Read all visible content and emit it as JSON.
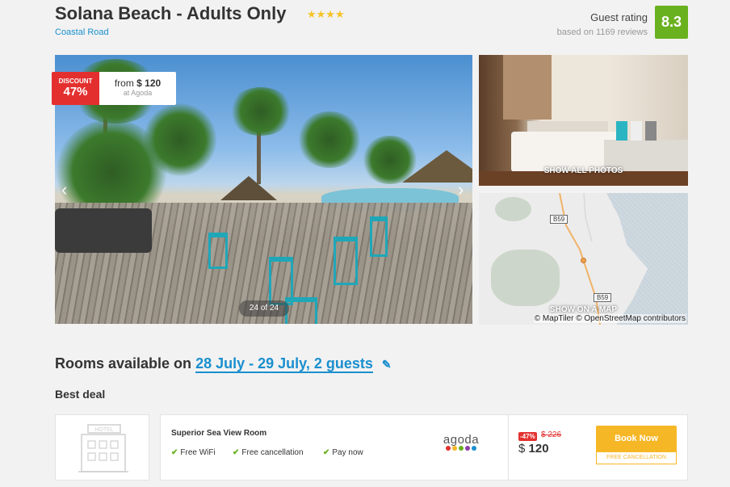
{
  "header": {
    "title": "Solana Beach - Adults Only",
    "stars": "★★★★",
    "address": "Coastal Road",
    "rating_label": "Guest rating",
    "rating_sub": "based on 1169 reviews",
    "rating_score": "8.3"
  },
  "gallery": {
    "discount_label": "DISCOUNT",
    "discount_pct": "47%",
    "from_label": "from",
    "from_price": "$ 120",
    "from_source": "at Agoda",
    "counter": "24 of 24",
    "show_all_photos": "SHOW ALL PHOTOS",
    "show_on_map": "SHOW ON A MAP",
    "map_attribution": "© MapTiler © OpenStreetMap contributors",
    "road_label": "B59",
    "road_label_2": "B59"
  },
  "rooms": {
    "title_prefix": "Rooms available on",
    "dates": "28 July - 29 July, 2 guests",
    "best_deal": "Best deal"
  },
  "deal": {
    "thumb_label": "HOTEL",
    "room_name": "Superior Sea View Room",
    "features": [
      "Free WiFi",
      "Free cancellation",
      "Pay now"
    ],
    "provider": "agoda",
    "provider_dot_colors": [
      "#e3302f",
      "#f6b727",
      "#6ab11f",
      "#8d3ea8",
      "#1a8fce"
    ],
    "discount_badge": "-47%",
    "old_price": "$ 226",
    "currency": "$",
    "price": "120",
    "book_button": "Book Now",
    "free_cancellation_tag": "FREE CANCELLATION"
  },
  "colors": {
    "accent": "#1a8fce",
    "rating_green": "#6ab11f",
    "discount_red": "#e3302f",
    "book_orange": "#f6b727"
  }
}
